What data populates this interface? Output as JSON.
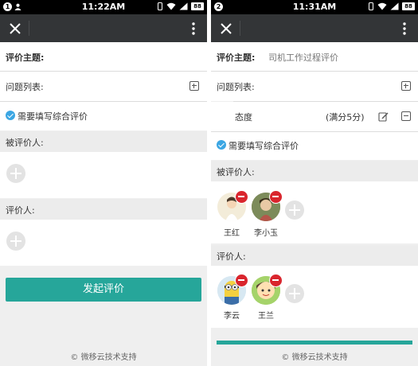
{
  "left": {
    "status": {
      "notification_count": "1",
      "time": "11:22AM",
      "battery": "88"
    },
    "form": {
      "topic_label": "评价主题:",
      "questions_label": "问题列表:",
      "overall_label": "需要填写综合评价",
      "evaluatees_label": "被评价人:",
      "evaluators_label": "评价人:",
      "submit_label": "发起评价"
    },
    "footer": "© 微移云技术支持"
  },
  "right": {
    "status": {
      "notification_count": "2",
      "time": "11:31AM",
      "battery": "88"
    },
    "form": {
      "topic_label": "评价主题:",
      "topic_value": "司机工作过程评价",
      "questions_label": "问题列表:",
      "question_name": "态度",
      "question_score": "(满分5分)",
      "overall_label": "需要填写综合评价",
      "evaluatees_label": "被评价人:",
      "evaluatees": [
        {
          "name": "王红"
        },
        {
          "name": "李小玉"
        }
      ],
      "evaluators_label": "评价人:",
      "evaluators": [
        {
          "name": "李云"
        },
        {
          "name": "王兰"
        }
      ]
    },
    "footer": "© 微移云技术支持"
  },
  "colors": {
    "accent": "#26a69a",
    "titlebar": "#333537",
    "remove": "#d9252d",
    "check": "#3ba6e3"
  },
  "icons": [
    "close-icon",
    "more-vert-icon",
    "plus-box-icon",
    "check-circle-icon",
    "add-person-icon",
    "edit-icon",
    "minus-box-icon",
    "remove-badge-icon"
  ]
}
